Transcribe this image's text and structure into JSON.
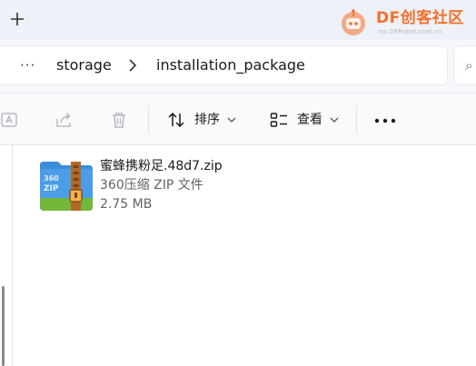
{
  "tab_strip": {
    "new_tab_icon": "plus-icon"
  },
  "watermark": {
    "brand": "DF创客社区",
    "url": "mc.DFRobot.com.cn",
    "color": "#f3702d"
  },
  "address_bar": {
    "more_label": "···",
    "crumbs": [
      "storage",
      "installation_package"
    ],
    "separator_icon": "chevron-right-icon",
    "search_stub_icon": "search-icon"
  },
  "command_bar": {
    "rename_icon": "rename-icon",
    "share_icon": "share-icon",
    "delete_icon": "trash-icon",
    "sort": {
      "label": "排序",
      "icon": "sort-arrows-icon"
    },
    "view": {
      "label": "查看",
      "icon": "view-list-icon"
    },
    "more_icon": "more-horizontal-icon"
  },
  "files": [
    {
      "name": "蜜蜂携粉足.48d7.zip",
      "type": "360压缩 ZIP 文件",
      "size": "2.75 MB",
      "icon": "zip-archive-icon",
      "icon_text": "360 ZIP"
    }
  ],
  "colors": {
    "accent": "#f3702d",
    "zip_blue": "#3a8ddb",
    "zip_green": "#73b83b",
    "zip_band": "#b06a24"
  }
}
